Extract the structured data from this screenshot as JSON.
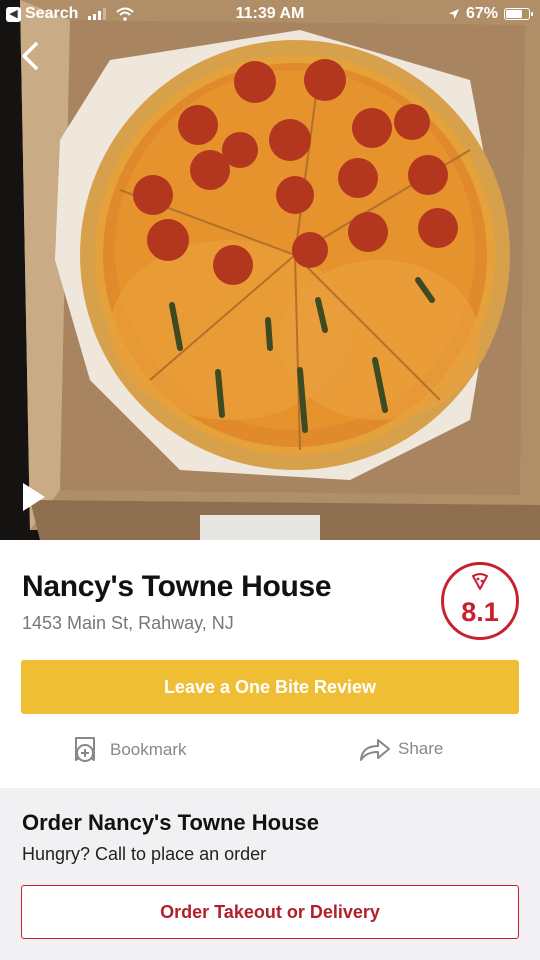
{
  "status_bar": {
    "back_app": "Search",
    "time": "11:39 AM",
    "battery": "67%",
    "battery_level": 0.67
  },
  "hero": {
    "image": "pizza-photo",
    "back_icon": "chevron-left-icon",
    "play_icon": "play-icon"
  },
  "restaurant": {
    "name": "Nancy's Towne House",
    "address": "1453 Main St, Rahway, NJ",
    "score": "8.1",
    "score_icon": "pizza-slice-icon",
    "accent_color": "#c8202f"
  },
  "actions": {
    "review_label": "Leave a One Bite Review",
    "review_color": "#f0be35",
    "bookmark_label": "Bookmark",
    "share_label": "Share"
  },
  "order": {
    "title": "Order Nancy's Towne House",
    "subtitle": "Hungry? Call to place an order",
    "button_label": "Order Takeout or Delivery"
  }
}
